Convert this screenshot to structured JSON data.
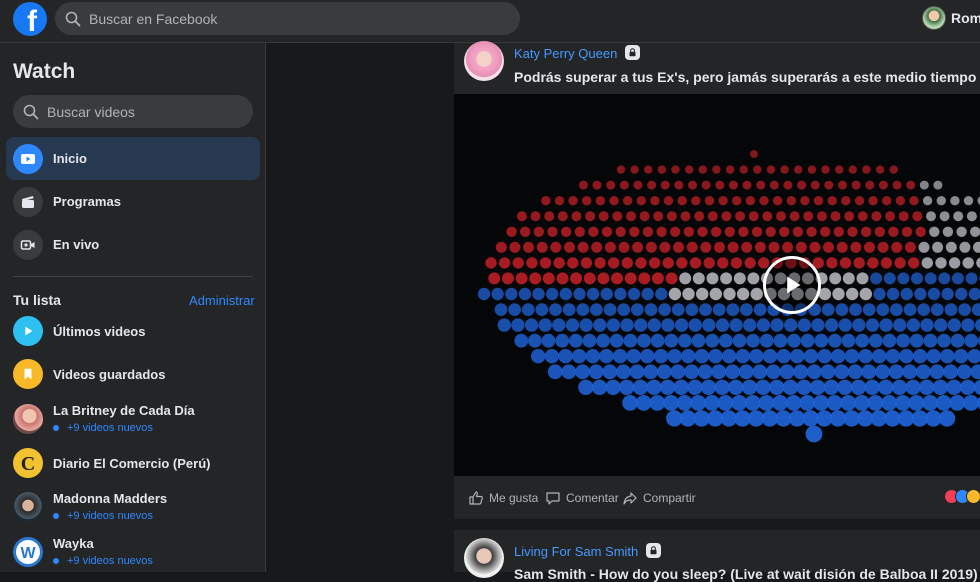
{
  "topbar": {
    "logo_letter": "f",
    "search_placeholder": "Buscar en Facebook",
    "user_name": "Romm"
  },
  "sidebar": {
    "title": "Watch",
    "search_placeholder": "Buscar videos",
    "nav": [
      {
        "label": "Inicio",
        "icon": "play-video-icon",
        "active": true
      },
      {
        "label": "Programas",
        "icon": "clapperboard-icon",
        "active": false
      },
      {
        "label": "En vivo",
        "icon": "live-camera-icon",
        "active": false
      }
    ],
    "list_title": "Tu lista",
    "list_admin": "Administrar",
    "list": [
      {
        "name": "Últimos videos",
        "sub": ""
      },
      {
        "name": "Videos guardados",
        "sub": ""
      },
      {
        "name": "La Britney de Cada Día",
        "sub": "+9 videos nuevos"
      },
      {
        "name": "Diario El Comercio (Perú)",
        "sub": ""
      },
      {
        "name": "Madonna Madders",
        "sub": "+9 videos nuevos"
      },
      {
        "name": "Wayka",
        "sub": "+9 videos nuevos"
      }
    ]
  },
  "feed": {
    "posts": [
      {
        "author": "Katy Perry Queen",
        "text": "Podrás superar a tus Ex's, pero jamás superarás a este medio tiempo d",
        "actions": {
          "like": "Me gusta",
          "comment": "Comentar",
          "share": "Compartir"
        }
      },
      {
        "author": "Living For Sam Smith",
        "text": "Sam Smith - How do you sleep? (Live at wait disión de Balboa II 2019)"
      }
    ]
  },
  "colors": {
    "accent": "#2d88ff",
    "background": "#18191a",
    "surface": "#242526"
  }
}
